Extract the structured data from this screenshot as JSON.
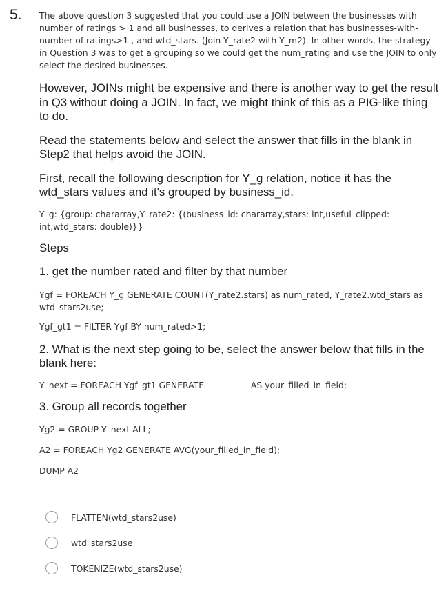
{
  "question": {
    "number": "5.",
    "intro": "The above question 3 suggested that you could use a JOIN between the businesses with number of ratings > 1 and all businesses, to derives a relation that has businesses-with-number-of-ratings>1 , and wtd_stars. (Join Y_rate2 with Y_m2). In other words, the strategy in Question 3 was to get a grouping so we could get the num_rating and use the JOIN to only select the desired businesses.",
    "however": "However, JOINs might be expensive and there is another way to get the result in Q3 without doing a JOIN. In fact, we might think of this as a PIG-like thing to do.",
    "read": "Read the statements below and select the answer that fills in the blank in Step2 that helps avoid the JOIN.",
    "first": "First, recall the following description for Y_g relation, notice it has the wtd_stars values and it's grouped by business_id.",
    "yg_schema": "Y_g: {group: chararray,Y_rate2: {(business_id: chararray,stars: int,useful_clipped: int,wtd_stars: double)}}",
    "steps_heading": "Steps",
    "step1_heading": "1. get the number rated and filter by that number",
    "step1_code1": "Ygf = FOREACH Y_g GENERATE COUNT(Y_rate2.stars) as num_rated, Y_rate2.wtd_stars as wtd_stars2use;",
    "step1_code2": "Ygf_gt1 = FILTER Ygf BY num_rated>1;",
    "step2_heading": "2. What is the next step going to be, select the answer below that fills in the blank here:",
    "step2_code_before": "Y_next = FOREACH Ygf_gt1 GENERATE ",
    "step2_code_after": " AS your_filled_in_field;",
    "step3_heading": "3. Group all records together",
    "step3_code1": "Yg2 = GROUP Y_next ALL;",
    "step3_code2": "A2 = FOREACH Yg2 GENERATE AVG(your_filled_in_field);",
    "step3_code3": "DUMP A2"
  },
  "options": [
    {
      "label": "FLATTEN(wtd_stars2use)",
      "selected": false
    },
    {
      "label": "wtd_stars2use",
      "selected": false
    },
    {
      "label": "TOKENIZE(wtd_stars2use)",
      "selected": false
    }
  ]
}
